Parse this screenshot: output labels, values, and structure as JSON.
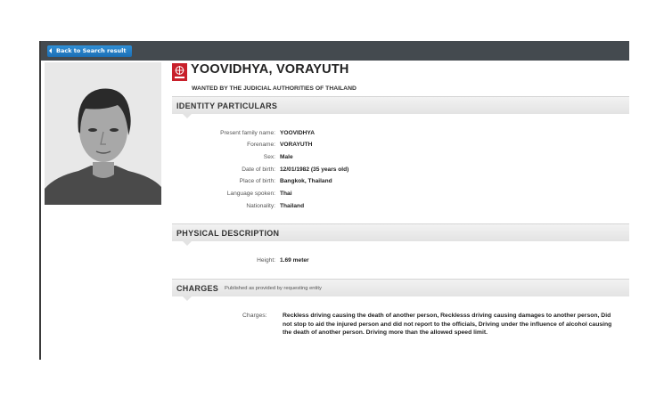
{
  "nav": {
    "back_label": "Back to Search result"
  },
  "person": {
    "name": "YOOVIDHYA, VORAYUTH",
    "wanted_by": "WANTED BY THE JUDICIAL AUTHORITIES OF THAILAND"
  },
  "identity": {
    "title": "IDENTITY PARTICULARS",
    "fields": [
      {
        "label": "Present family name:",
        "value": "YOOVIDHYA"
      },
      {
        "label": "Forename:",
        "value": "VORAYUTH"
      },
      {
        "label": "Sex:",
        "value": "Male"
      },
      {
        "label": "Date of birth:",
        "value": "12/01/1982 (35 years old)"
      },
      {
        "label": "Place of birth:",
        "value": "Bangkok, Thailand"
      },
      {
        "label": "Language spoken:",
        "value": "Thai"
      },
      {
        "label": "Nationality:",
        "value": "Thailand"
      }
    ]
  },
  "physical": {
    "title": "PHYSICAL DESCRIPTION",
    "fields": [
      {
        "label": "Height:",
        "value": "1.69 meter"
      }
    ]
  },
  "charges": {
    "title": "CHARGES",
    "subtitle": "Published as provided by requesting entity",
    "label": "Charges:",
    "text": "Reckless driving causing the death of another person, Recklesss driving causing damages to another person, Did not stop to aid the injured person and did not report to the officials, Driving under the influence of alcohol causing the death of another person. Driving more than the allowed speed limit."
  },
  "icons": {
    "emblem": "interpol-emblem-icon",
    "back": "back-arrow-icon",
    "photo": "person-photo"
  }
}
